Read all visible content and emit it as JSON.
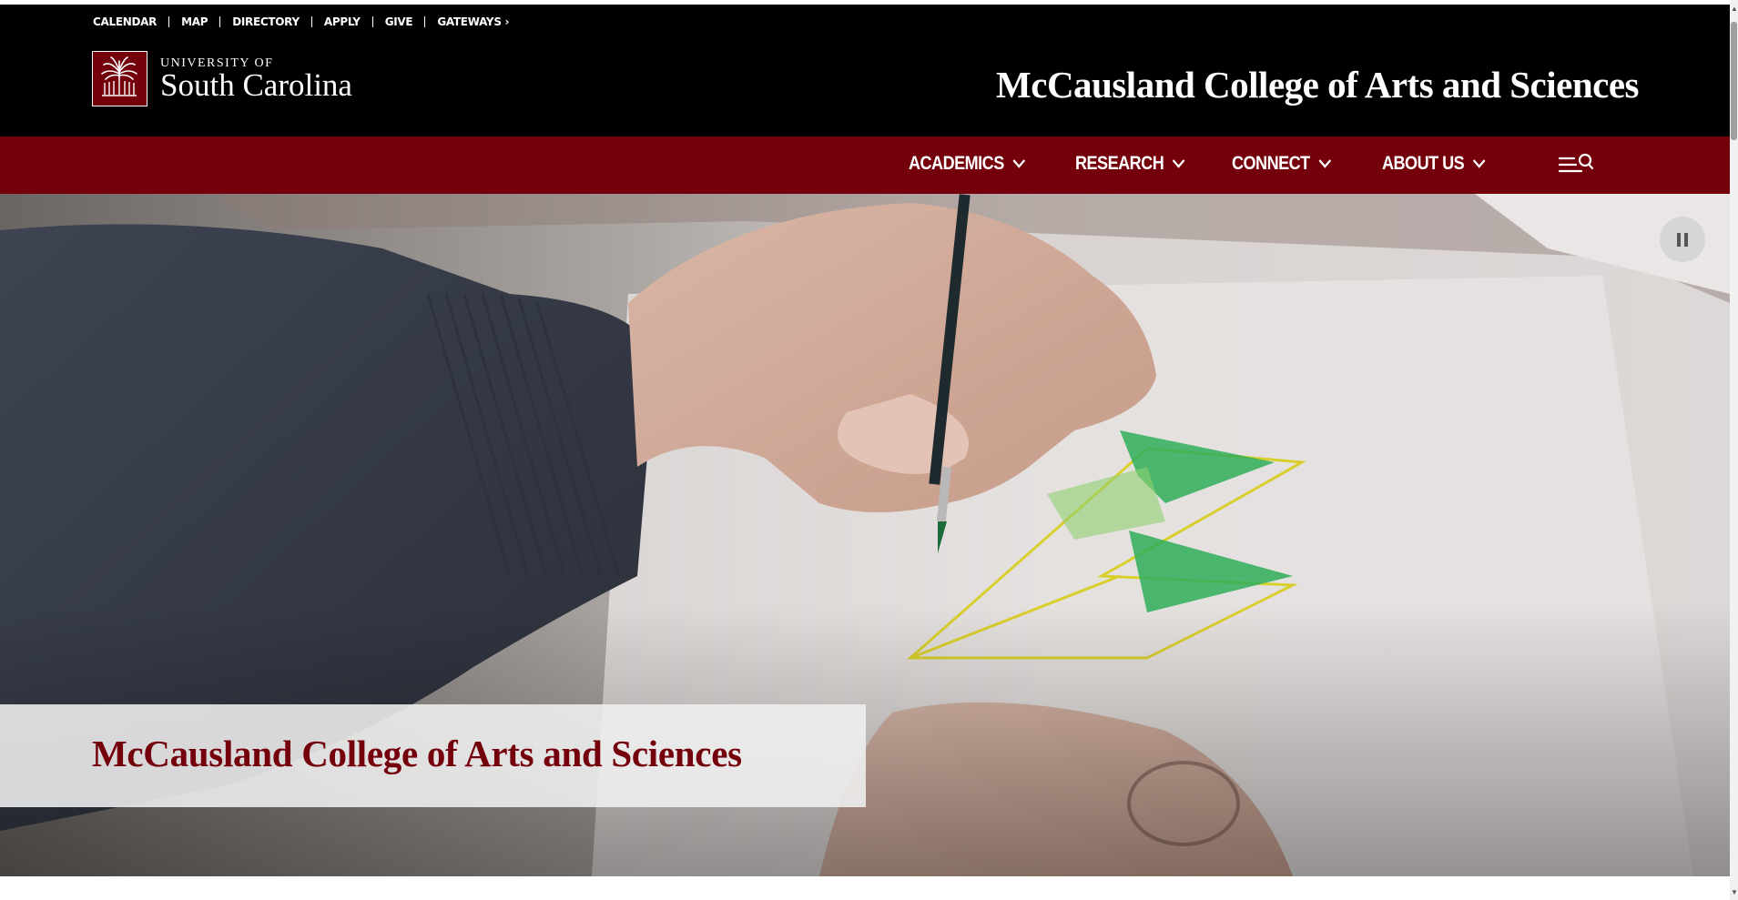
{
  "utility_nav": {
    "items": [
      "CALENDAR",
      "MAP",
      "DIRECTORY",
      "APPLY",
      "GIVE",
      "GATEWAYS ›"
    ]
  },
  "logo": {
    "line1": "UNIVERSITY OF",
    "line2": "South Carolina",
    "icon": "palmetto-tree-icon"
  },
  "header": {
    "college_title": "McCausland College of Arts and Sciences"
  },
  "main_nav": {
    "items": [
      {
        "label": "ACADEMICS"
      },
      {
        "label": "RESEARCH"
      },
      {
        "label": "CONNECT"
      },
      {
        "label": "ABOUT US"
      }
    ],
    "menu_search_icon": "menu-search-icon"
  },
  "hero": {
    "caption": "McCausland College of Arts and Sciences",
    "pause_icon": "pause-icon"
  },
  "colors": {
    "garnet": "#73000a",
    "black": "#000000",
    "white": "#ffffff"
  }
}
